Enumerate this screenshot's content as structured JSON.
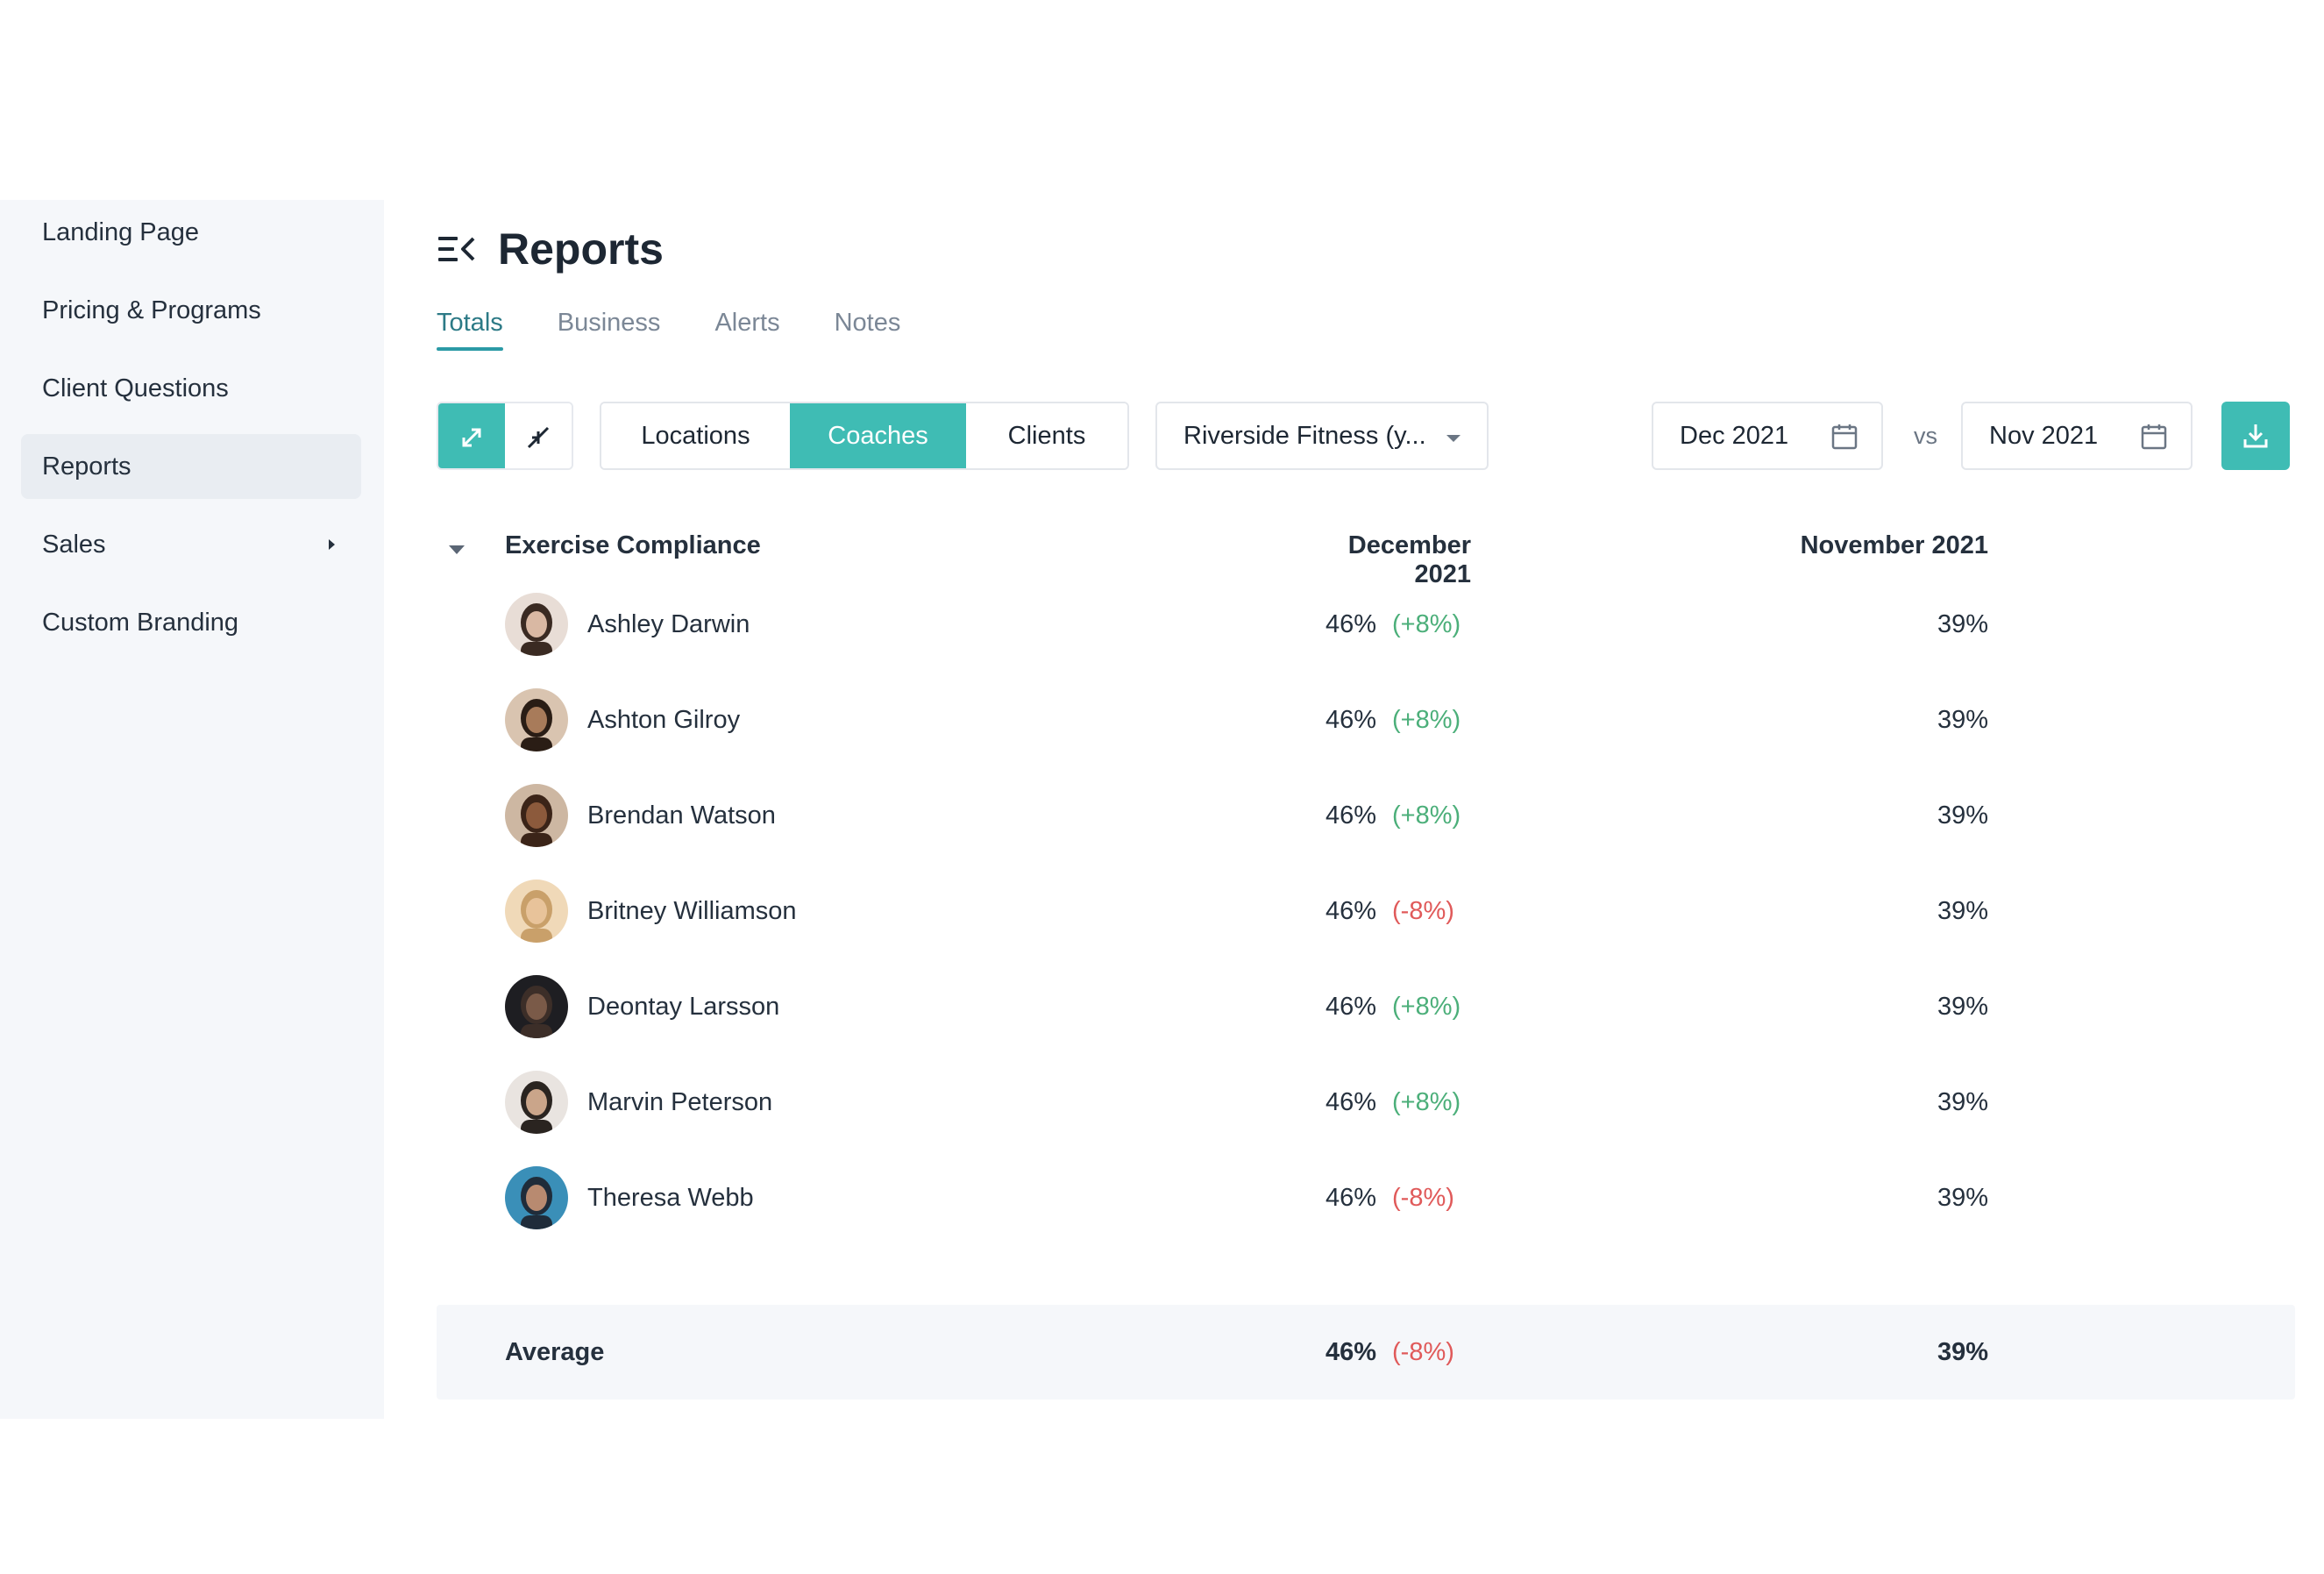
{
  "sidebar": {
    "items": [
      {
        "label": "Landing Page"
      },
      {
        "label": "Pricing & Programs"
      },
      {
        "label": "Client Questions"
      },
      {
        "label": "Reports"
      },
      {
        "label": "Sales"
      },
      {
        "label": "Custom Branding"
      }
    ]
  },
  "header": {
    "title": "Reports",
    "menu_icon": "collapse-menu-icon"
  },
  "tabs": [
    {
      "label": "Totals"
    },
    {
      "label": "Business"
    },
    {
      "label": "Alerts"
    },
    {
      "label": "Notes"
    }
  ],
  "toolbar": {
    "expand_icon": "expand-icon",
    "collapse_icon": "collapse-icon",
    "segments": [
      {
        "label": "Locations"
      },
      {
        "label": "Coaches"
      },
      {
        "label": "Clients"
      }
    ],
    "location_select": "Riverside Fitness (y...",
    "date_current": "Dec 2021",
    "vs_label": "vs",
    "date_compare": "Nov 2021",
    "download_icon": "download-icon"
  },
  "table": {
    "section_label": "Exercise Compliance",
    "col_current": "December 2021",
    "col_previous": "November 2021",
    "rows": [
      {
        "name": "Ashley Darwin",
        "current": "46%",
        "delta": "(+8%)",
        "delta_sign": "pos",
        "previous": "39%"
      },
      {
        "name": "Ashton Gilroy",
        "current": "46%",
        "delta": "(+8%)",
        "delta_sign": "pos",
        "previous": "39%"
      },
      {
        "name": "Brendan Watson",
        "current": "46%",
        "delta": "(+8%)",
        "delta_sign": "pos",
        "previous": "39%"
      },
      {
        "name": "Britney Williamson",
        "current": "46%",
        "delta": "(-8%)",
        "delta_sign": "neg",
        "previous": "39%"
      },
      {
        "name": "Deontay Larsson",
        "current": "46%",
        "delta": "(+8%)",
        "delta_sign": "pos",
        "previous": "39%"
      },
      {
        "name": "Marvin Peterson",
        "current": "46%",
        "delta": "(+8%)",
        "delta_sign": "pos",
        "previous": "39%"
      },
      {
        "name": "Theresa Webb",
        "current": "46%",
        "delta": "(-8%)",
        "delta_sign": "neg",
        "previous": "39%"
      }
    ],
    "average": {
      "label": "Average",
      "current": "46%",
      "delta": "(-8%)",
      "delta_sign": "neg",
      "previous": "39%"
    }
  },
  "colors": {
    "accent": "#3fbcb4",
    "positive": "#4caf7a",
    "negative": "#e05a5a"
  }
}
